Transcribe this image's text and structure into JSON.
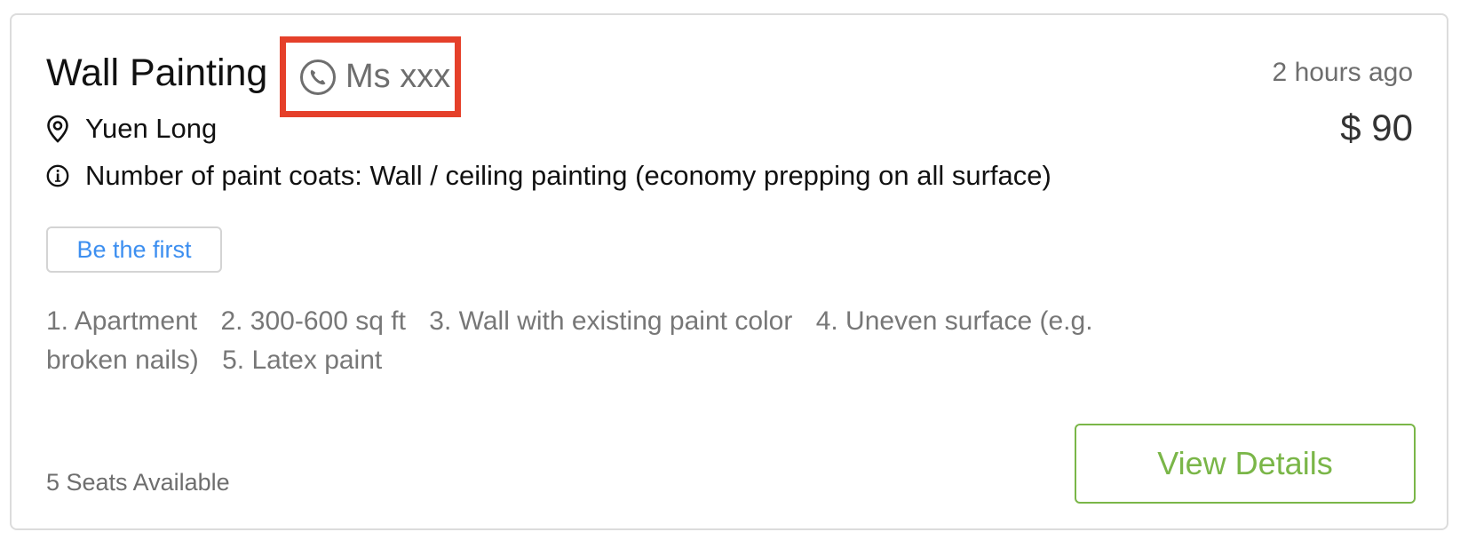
{
  "job": {
    "title": "Wall Painting",
    "contact_name": "Ms xxx",
    "posted_time": "2 hours ago",
    "price": "$ 90",
    "location": "Yuen Long",
    "info": "Number of paint coats: Wall / ceiling painting (economy prepping on all surface)",
    "badge": "Be the first",
    "specs": [
      "1. Apartment",
      "2. 300-600 sq ft",
      "3. Wall with existing paint color",
      "4. Uneven surface (e.g. broken nails)",
      "5. Latex paint"
    ],
    "seats": "5 Seats Available",
    "view_details_label": "View Details"
  },
  "icons": {
    "phone": "phone-icon",
    "location": "location-pin-icon",
    "info": "info-icon"
  },
  "colors": {
    "highlight_box": "#e5402a",
    "badge_text": "#3d8ff0",
    "button_accent": "#7ab648"
  }
}
